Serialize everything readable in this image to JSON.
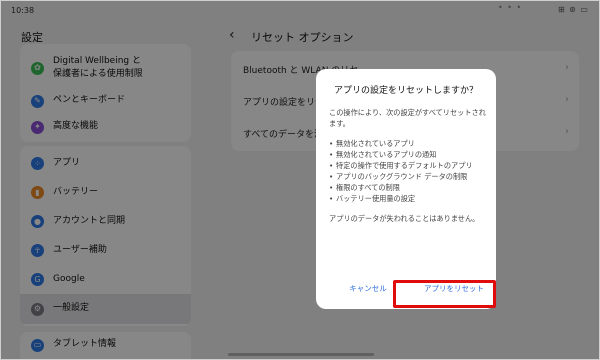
{
  "status": {
    "time": "10:38",
    "right_icons": "⊞ ⊛ ▭"
  },
  "sidebar": {
    "title": "設定",
    "card1": [
      {
        "label": "Digital Wellbeing と\n保護者による使用制限",
        "icon": "wellbeing-icon",
        "color": "#3cbf58"
      },
      {
        "label": "ペンとキーボード",
        "icon": "pen-icon",
        "color": "#2f7bea"
      },
      {
        "label": "高度な機能",
        "icon": "advanced-icon",
        "color": "#8a4fd8"
      }
    ],
    "card2": [
      {
        "label": "アプリ",
        "icon": "apps-icon",
        "color": "#2f7bea"
      },
      {
        "label": "バッテリー",
        "icon": "battery-icon",
        "color": "#f08a24"
      },
      {
        "label": "アカウントと同期",
        "icon": "account-icon",
        "color": "#2f7bea"
      },
      {
        "label": "ユーザー補助",
        "icon": "accessibility-icon",
        "color": "#2f7bea"
      },
      {
        "label": "Google",
        "icon": "google-icon",
        "color": "#2f7bea"
      },
      {
        "label": "一般設定",
        "icon": "general-settings-icon",
        "color": "#7d7d85"
      }
    ],
    "card3": [
      {
        "label": "タブレット情報",
        "icon": "tablet-info-icon",
        "color": "#2f7bea"
      }
    ]
  },
  "reset_page": {
    "title": "リセット オプション",
    "rows": [
      "Bluetooth と WLAN のリセ",
      "アプリの設定をリセ",
      "すべてのデータを消"
    ]
  },
  "dialog": {
    "title": "アプリの設定をリセットしますか？",
    "intro": "この操作により、次の設定がすべてリセットされます。",
    "bullets": [
      "無効化されているアプリ",
      "無効化されているアプリの通知",
      "特定の操作で使用するデフォルトのアプリ",
      "アプリのバックグラウンド データの制限",
      "権限のすべての制限",
      "バッテリー使用量の設定"
    ],
    "note": "アプリのデータが失われることはありません。",
    "cancel_label": "キャンセル",
    "reset_label": "アプリをリセット"
  },
  "colors": {
    "accent": "#2f6fe0",
    "highlight": "#e00b0b"
  }
}
